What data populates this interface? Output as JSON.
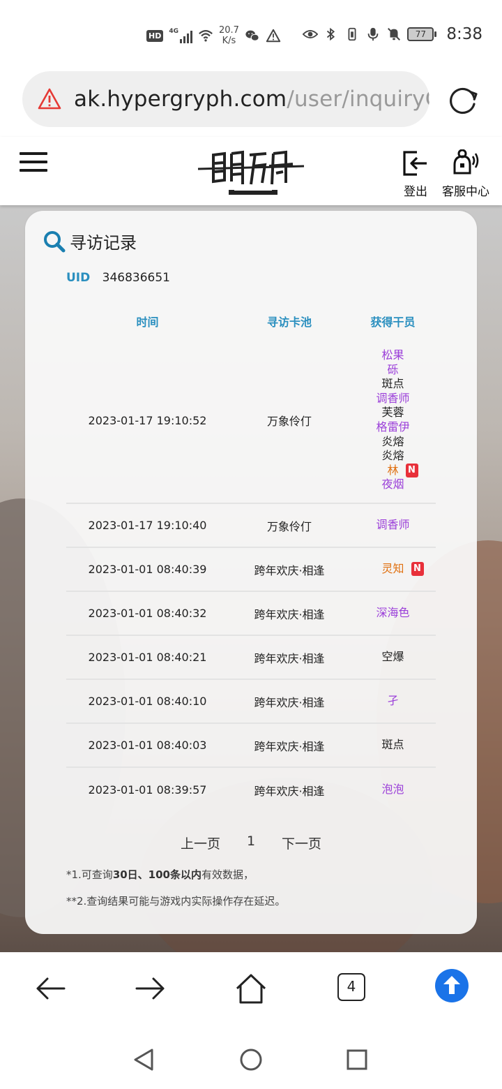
{
  "status_bar": {
    "hd": "HD",
    "network_type": "4G",
    "speed_value": "20.7",
    "speed_unit": "K/s",
    "battery": "77",
    "time": "8:38"
  },
  "browser": {
    "url_domain": "ak.hypergryph.com",
    "url_path": "/user/inquiryGa",
    "tab_count": "4"
  },
  "header": {
    "logout_label": "登出",
    "service_label": "客服中心"
  },
  "card": {
    "title": "寻访记录",
    "uid_label": "UID",
    "uid_value": "346836651",
    "columns": {
      "time": "时间",
      "pool": "寻访卡池",
      "operators": "获得干员"
    },
    "pagination": {
      "prev": "上一页",
      "page": "1",
      "next": "下一页"
    },
    "note1_prefix": "*1.可查询",
    "note1_bold": "30日、100条以内",
    "note1_suffix": "有效数据，",
    "note2": "**2.查询结果可能与游戏内实际操作存在延迟。"
  },
  "records": [
    {
      "time": "2023-01-17 19:10:52",
      "pool": "万象伶仃",
      "operators": [
        {
          "name": "松果",
          "rarity": "purple"
        },
        {
          "name": "砾",
          "rarity": "purple"
        },
        {
          "name": "斑点",
          "rarity": "normal"
        },
        {
          "name": "调香师",
          "rarity": "purple"
        },
        {
          "name": "芙蓉",
          "rarity": "normal"
        },
        {
          "name": "格雷伊",
          "rarity": "purple"
        },
        {
          "name": "炎熔",
          "rarity": "normal"
        },
        {
          "name": "炎熔",
          "rarity": "normal"
        },
        {
          "name": "林",
          "rarity": "orange",
          "new": "N"
        },
        {
          "name": "夜烟",
          "rarity": "purple"
        }
      ]
    },
    {
      "time": "2023-01-17 19:10:40",
      "pool": "万象伶仃",
      "operators": [
        {
          "name": "调香师",
          "rarity": "purple"
        }
      ]
    },
    {
      "time": "2023-01-01 08:40:39",
      "pool": "跨年欢庆·相逢",
      "operators": [
        {
          "name": "灵知",
          "rarity": "orange",
          "new": "N"
        }
      ]
    },
    {
      "time": "2023-01-01 08:40:32",
      "pool": "跨年欢庆·相逢",
      "operators": [
        {
          "name": "深海色",
          "rarity": "purple"
        }
      ]
    },
    {
      "time": "2023-01-01 08:40:21",
      "pool": "跨年欢庆·相逢",
      "operators": [
        {
          "name": "空爆",
          "rarity": "normal"
        }
      ]
    },
    {
      "time": "2023-01-01 08:40:10",
      "pool": "跨年欢庆·相逢",
      "operators": [
        {
          "name": "孑",
          "rarity": "purple"
        }
      ]
    },
    {
      "time": "2023-01-01 08:40:03",
      "pool": "跨年欢庆·相逢",
      "operators": [
        {
          "name": "斑点",
          "rarity": "normal"
        }
      ]
    },
    {
      "time": "2023-01-01 08:39:57",
      "pool": "跨年欢庆·相逢",
      "operators": [
        {
          "name": "泡泡",
          "rarity": "purple"
        }
      ]
    }
  ],
  "colors": {
    "accent_blue": "#2a8fbf",
    "rarity_purple": "#9b3fd9",
    "rarity_orange": "#e07010",
    "new_badge": "#e8303a",
    "scroll_up_button": "#1a73e8"
  },
  "icons": {
    "logo": "arknights-logo",
    "logout": "logout-icon",
    "service": "customer-service-icon"
  }
}
